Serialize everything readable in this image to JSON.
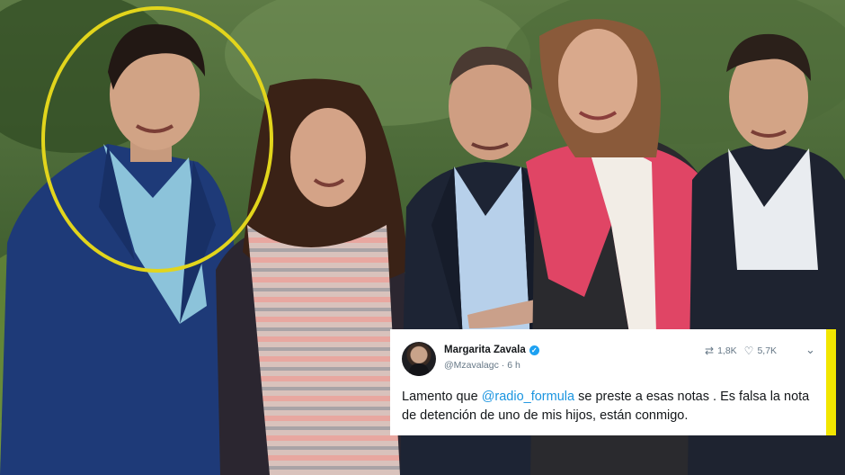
{
  "photo": {
    "description_icon": "family-photo",
    "highlight_color": "#e2d51c"
  },
  "tweet": {
    "author_name": "Margarita Zavala",
    "handle": "@Mzavalagc",
    "separator": "·",
    "time": "6 h",
    "retweets": "1,8K",
    "likes": "5,7K",
    "text_before": "Lamento que ",
    "mention": "@radio_formula",
    "text_after": " se preste a esas notas . Es falsa la nota de detención de uno de mis hijos, están conmigo.",
    "accent_color": "#f2e600",
    "link_color": "#1b95e0"
  }
}
